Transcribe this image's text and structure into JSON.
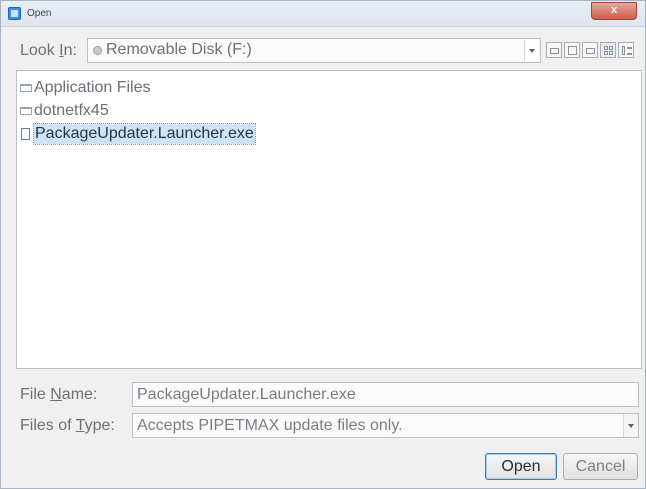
{
  "window": {
    "title": "Open",
    "close_glyph": "x"
  },
  "look_in": {
    "label_prefix": "Look ",
    "label_mnemonic": "I",
    "label_suffix": "n:",
    "value": "Removable Disk (F:)",
    "icon": "disk-icon"
  },
  "toolbar": {
    "buttons": [
      "up-folder-icon",
      "home-icon",
      "new-folder-icon",
      "list-view-icon",
      "details-view-icon"
    ]
  },
  "files": [
    {
      "name": "Application Files",
      "type": "folder",
      "selected": false
    },
    {
      "name": "dotnetfx45",
      "type": "folder",
      "selected": false
    },
    {
      "name": "PackageUpdater.Launcher.exe",
      "type": "file",
      "selected": true
    }
  ],
  "file_name": {
    "label_prefix": "File ",
    "label_mnemonic": "N",
    "label_suffix": "ame:",
    "value": "PackageUpdater.Launcher.exe"
  },
  "file_type": {
    "label_prefix": "Files of ",
    "label_mnemonic": "T",
    "label_suffix": "ype:",
    "value": "Accepts PIPETMAX update files only."
  },
  "buttons": {
    "open": "Open",
    "cancel": "Cancel"
  }
}
